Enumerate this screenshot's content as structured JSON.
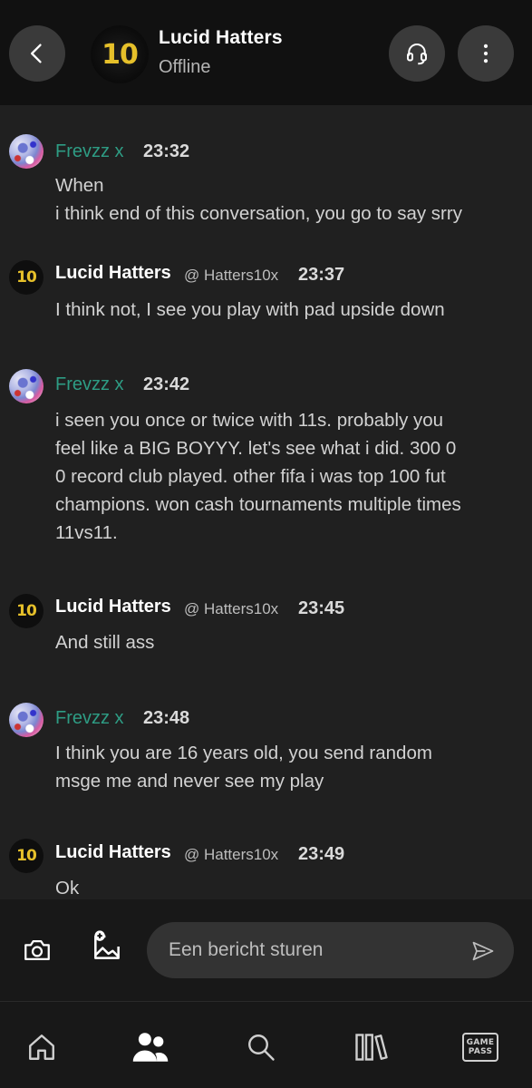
{
  "header": {
    "title": "Lucid Hatters",
    "status": "Offline",
    "avatar_text": "10"
  },
  "messages": [
    {
      "sender": "Frevzz x",
      "handle": "",
      "time": "23:32",
      "avatar": "frevzz",
      "text_lines": [
        "When",
        "i think end of this conversation, you go to say srry"
      ]
    },
    {
      "sender": "Lucid Hatters",
      "handle": "@ Hatters10x",
      "time": "23:37",
      "avatar": "lucid",
      "text_lines": [
        "I think not, I see you play with pad upside down"
      ]
    },
    {
      "sender": "Frevzz x",
      "handle": "",
      "time": "23:42",
      "avatar": "frevzz",
      "text_lines": [
        "i seen you once or twice with 11s. probably you",
        "feel like a BIG BOYYY. let's see what i did. 300 0",
        "0 record club played. other fifa i was top 100 fut",
        "champions. won cash tournaments multiple times",
        "11vs11."
      ]
    },
    {
      "sender": "Lucid Hatters",
      "handle": "@ Hatters10x",
      "time": "23:45",
      "avatar": "lucid",
      "text_lines": [
        "And still ass"
      ]
    },
    {
      "sender": "Frevzz x",
      "handle": "",
      "time": "23:48",
      "avatar": "frevzz",
      "text_lines": [
        "I think you are 16 years old, you send random",
        "msge me and never see my play"
      ]
    },
    {
      "sender": "Lucid Hatters",
      "handle": "@ Hatters10x",
      "time": "23:49",
      "avatar": "lucid",
      "text_lines": [
        "Ok"
      ]
    }
  ],
  "composer": {
    "placeholder": "Een bericht sturen"
  },
  "bottom_nav": {
    "items": [
      "home-icon",
      "friends-icon",
      "search-icon",
      "library-icon",
      "game-pass-icon"
    ],
    "gamepass_line1": "GAME",
    "gamepass_line2": "PASS"
  },
  "colors": {
    "background": "#202020",
    "header": "#111111",
    "frevzz_name": "#2e9c84",
    "gold": "#e6c02a"
  }
}
